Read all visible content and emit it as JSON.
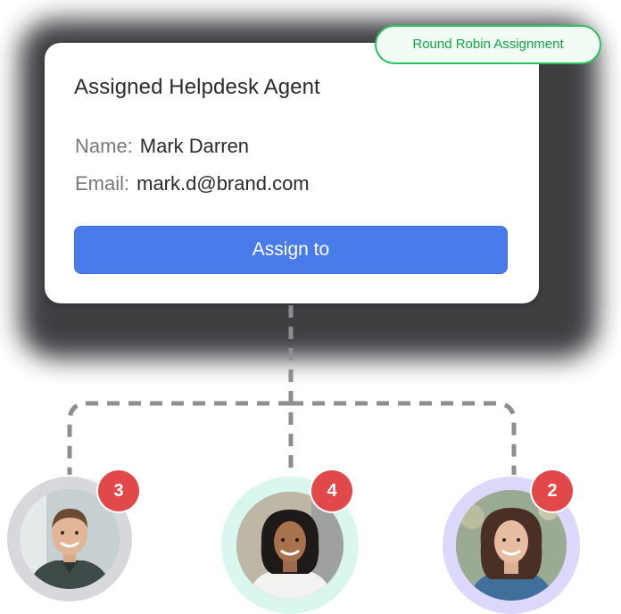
{
  "card": {
    "title": "Assigned Helpdesk Agent",
    "name_label": "Name:",
    "name_value": "Mark Darren",
    "email_label": "Email:",
    "email_value": "mark.d@brand.com",
    "button_label": "Assign to"
  },
  "assignment_badge": "Round Robin Assignment",
  "agents": [
    {
      "count": "3",
      "avatar": "man-smiling-avatar",
      "ring_color": "#d8d8dc"
    },
    {
      "count": "4",
      "avatar": "woman-smiling-avatar",
      "ring_color": "#d9f7ee"
    },
    {
      "count": "2",
      "avatar": "woman-smiling-avatar",
      "ring_color": "#dcd8fb"
    }
  ],
  "colors": {
    "button": "#4a7bea",
    "badge_border": "#27c35f",
    "badge_text": "#14a446",
    "count_badge": "#e0484a",
    "connector": "#8d8d92"
  }
}
